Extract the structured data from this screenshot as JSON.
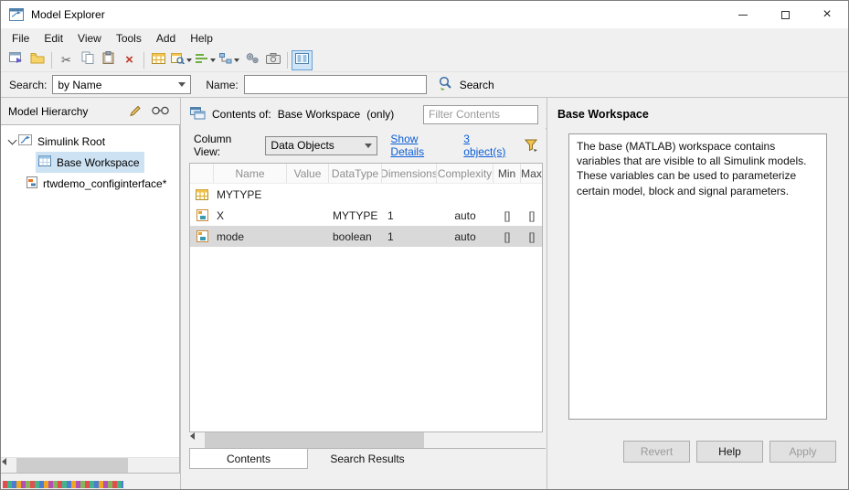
{
  "window": {
    "title": "Model Explorer"
  },
  "menu": {
    "items": [
      {
        "label": "File"
      },
      {
        "label": "Edit"
      },
      {
        "label": "View"
      },
      {
        "label": "Tools"
      },
      {
        "label": "Add"
      },
      {
        "label": "Help"
      }
    ]
  },
  "searchbar": {
    "search_label": "Search:",
    "search_mode_value": "by Name",
    "name_label": "Name:",
    "name_value": "",
    "search_button_label": "Search"
  },
  "hierarchy": {
    "title": "Model Hierarchy",
    "items": [
      {
        "label": "Simulink Root"
      },
      {
        "label": "Base Workspace"
      },
      {
        "label": "rtwdemo_configinterface*"
      }
    ]
  },
  "contents": {
    "header_label": "Contents of:",
    "header_target": "Base Workspace",
    "header_suffix": "(only)",
    "filter_placeholder": "Filter Contents",
    "column_view_label": "Column View:",
    "column_view_value": "Data Objects",
    "show_details_link": "Show Details",
    "object_count_link": "3 object(s)",
    "columns": [
      "Name",
      "Value",
      "DataType",
      "Dimensions",
      "Complexity",
      "Min",
      "Max"
    ],
    "rows": [
      {
        "name": "MYTYPE",
        "value": "",
        "datatype": "",
        "dimensions": "",
        "complexity": "",
        "min": "",
        "max": ""
      },
      {
        "name": "X",
        "value": "",
        "datatype": "MYTYPE",
        "dimensions": "1",
        "complexity": "auto",
        "min": "[]",
        "max": "[]"
      },
      {
        "name": "mode",
        "value": "",
        "datatype": "boolean",
        "dimensions": "1",
        "complexity": "auto",
        "min": "[]",
        "max": "[]"
      }
    ],
    "tabs": [
      {
        "label": "Contents"
      },
      {
        "label": "Search Results"
      }
    ]
  },
  "detail": {
    "title": "Base Workspace",
    "description": "The base (MATLAB) workspace contains variables that are visible to all Simulink models. These variables can be used to parameterize certain model, block and signal parameters.",
    "buttons": [
      {
        "label": "Revert"
      },
      {
        "label": "Help"
      },
      {
        "label": "Apply"
      }
    ]
  }
}
